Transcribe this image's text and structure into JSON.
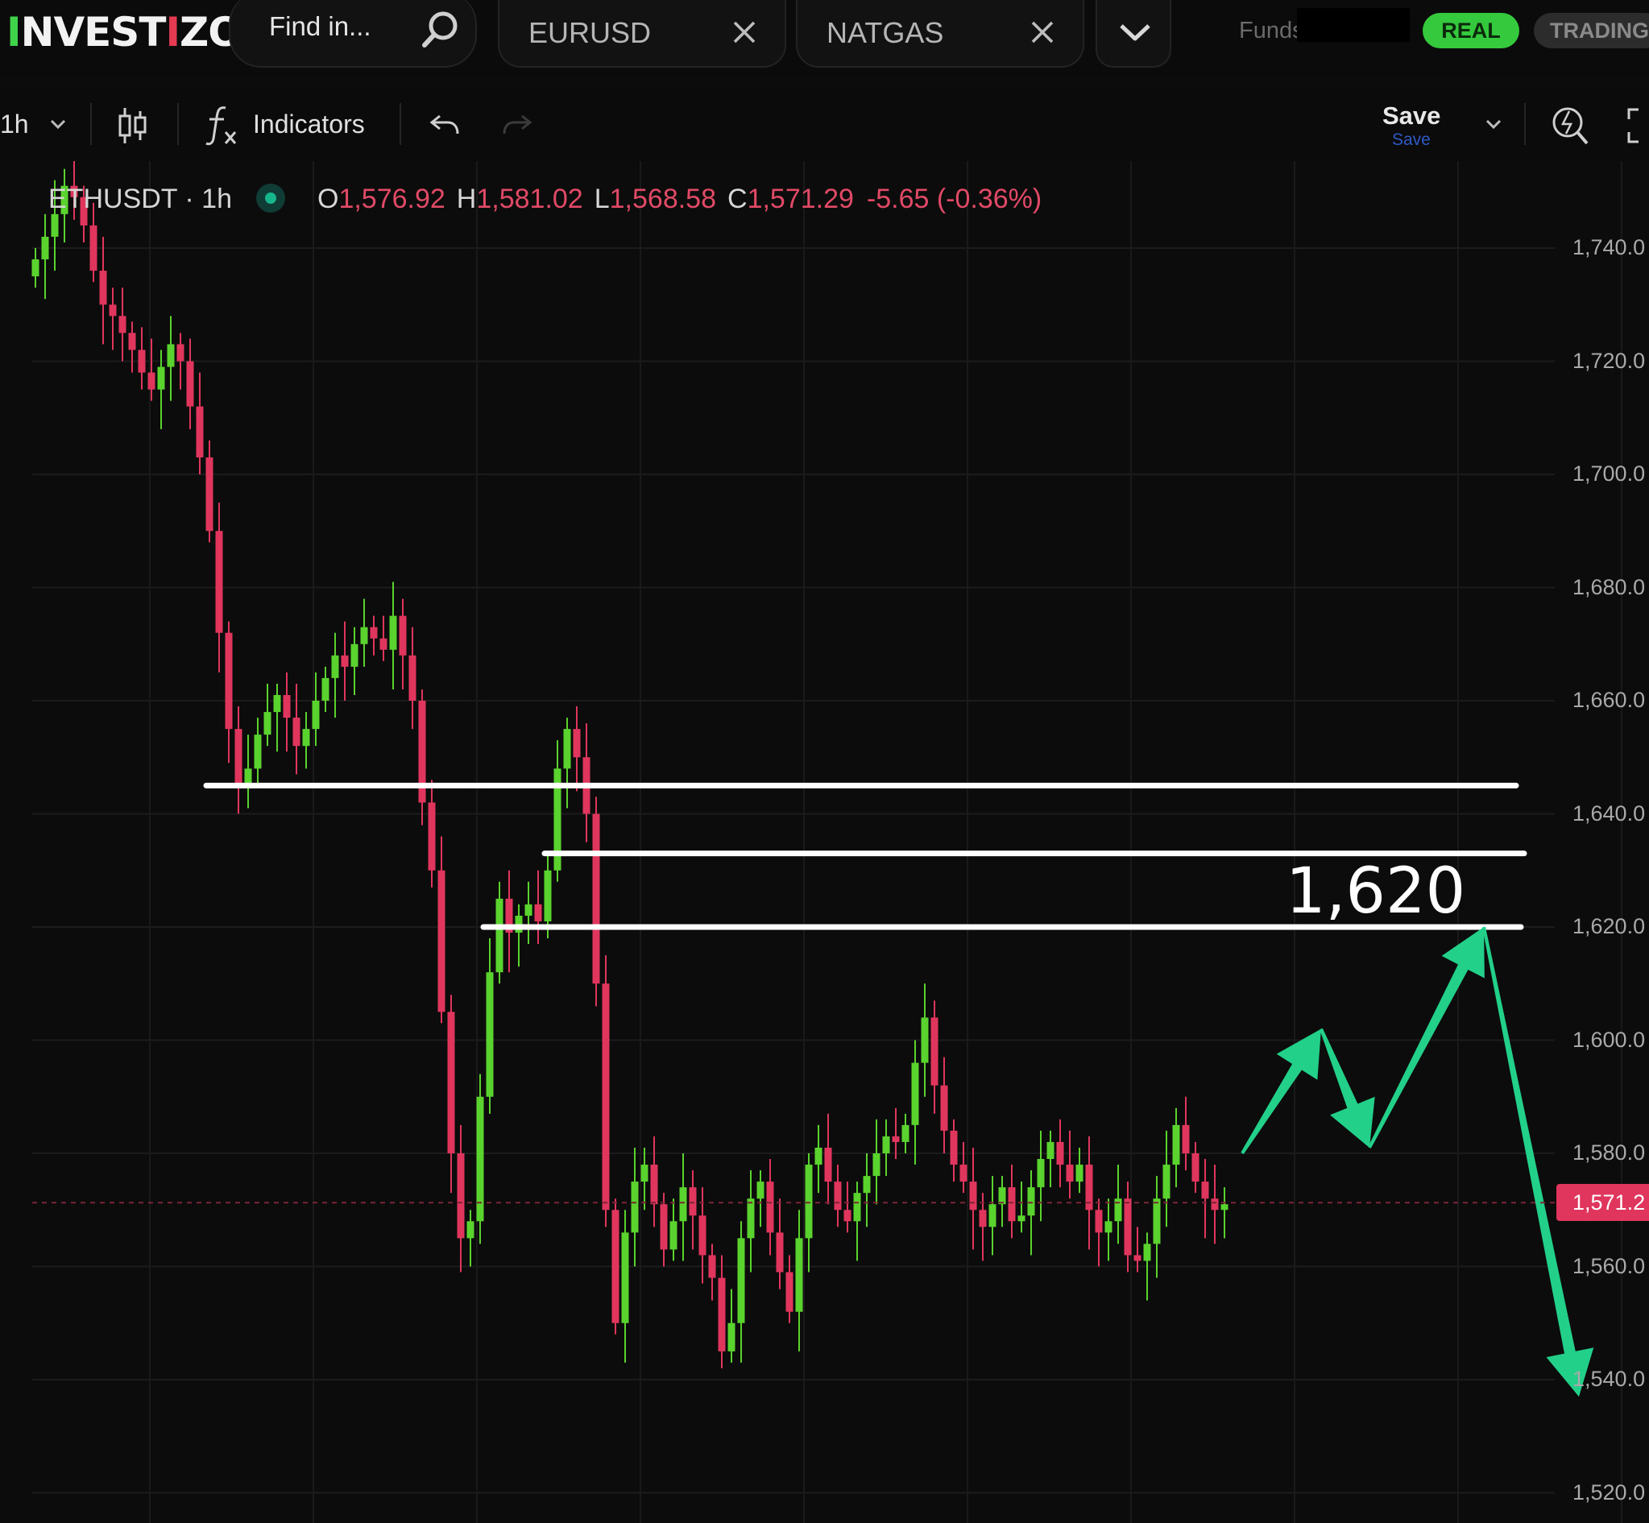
{
  "brand": {
    "logo_text": "INVESTIZO",
    "logo_head": "I",
    "logo_mid": "NVEST",
    "logo_i": "I",
    "logo_tail": "ZO"
  },
  "topbar": {
    "search_placeholder": "Find in...",
    "tabs": [
      {
        "label": "EURUSD"
      },
      {
        "label": "NATGAS"
      }
    ],
    "funds_label": "Funds",
    "real_label": "REAL",
    "trading_label": "TRADING"
  },
  "toolbar": {
    "timeframe": "1h",
    "indicators_label": "Indicators",
    "save_label": "Save",
    "save_sublabel": "Save"
  },
  "legend": {
    "symbol": "ETHUSDT · 1h",
    "open_key": "O",
    "open": "1,576.92",
    "high_key": "H",
    "high": "1,581.02",
    "low_key": "L",
    "low": "1,568.58",
    "close_key": "C",
    "close": "1,571.29",
    "change": "-5.65 (-0.36%)"
  },
  "annotation": {
    "level_label": "1,620"
  },
  "colors": {
    "up": "#5ad32f",
    "down": "#e0365e",
    "arrow": "#22d08a",
    "hline": "#ffffff",
    "accent_real": "#35c93e"
  },
  "chart_data": {
    "type": "candlestick",
    "symbol": "ETHUSDT",
    "interval": "1h",
    "y_ticks": [
      "1,740.0",
      "1,720.0",
      "1,700.0",
      "1,680.0",
      "1,660.0",
      "1,640.0",
      "1,620.0",
      "1,600.0",
      "1,580.0",
      "1,560.0",
      "1,540.0",
      "1,520.0"
    ],
    "ylim": [
      1515,
      1755
    ],
    "last_price": 1571.29,
    "last_price_label": "1,571.2",
    "horizontal_levels": [
      1645,
      1633,
      1620
    ],
    "path_projection": [
      1580,
      1602,
      1581,
      1620,
      1537
    ],
    "grid": true,
    "ohlc_close_series": [
      1738,
      1742,
      1746,
      1751,
      1749,
      1744,
      1736,
      1730,
      1728,
      1725,
      1722,
      1718,
      1715,
      1719,
      1723,
      1720,
      1712,
      1703,
      1690,
      1672,
      1655,
      1645,
      1648,
      1654,
      1658,
      1661,
      1657,
      1652,
      1655,
      1660,
      1664,
      1668,
      1666,
      1670,
      1673,
      1671,
      1669,
      1675,
      1668,
      1660,
      1642,
      1630,
      1605,
      1580,
      1565,
      1568,
      1590,
      1612,
      1625,
      1619,
      1622,
      1624,
      1621,
      1630,
      1648,
      1655,
      1650,
      1640,
      1610,
      1570,
      1550,
      1566,
      1575,
      1578,
      1571,
      1563,
      1568,
      1574,
      1569,
      1562,
      1558,
      1545,
      1550,
      1565,
      1572,
      1575,
      1566,
      1559,
      1552,
      1565,
      1578,
      1581,
      1575,
      1570,
      1568,
      1573,
      1576,
      1580,
      1583,
      1582,
      1585,
      1596,
      1604,
      1592,
      1584,
      1578,
      1575,
      1570,
      1567,
      1571,
      1574,
      1568,
      1569,
      1574,
      1579,
      1582,
      1578,
      1575,
      1578,
      1570,
      1566,
      1568,
      1572,
      1562,
      1561,
      1564,
      1572,
      1578,
      1585,
      1580,
      1575,
      1572,
      1570,
      1571
    ]
  }
}
